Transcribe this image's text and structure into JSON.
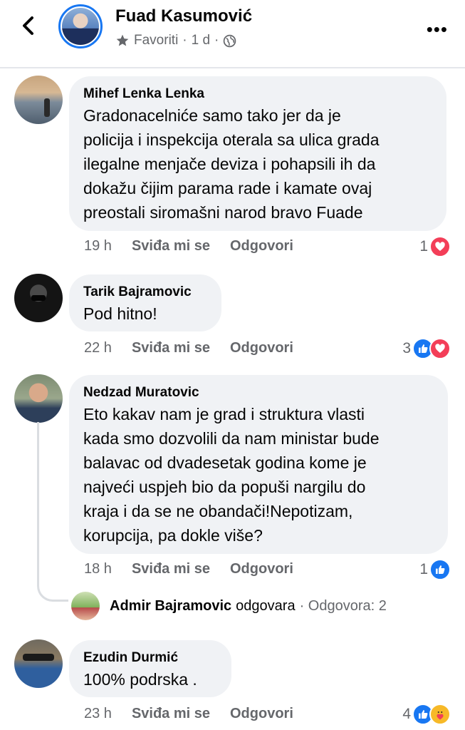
{
  "header": {
    "title": "Fuad Kasumović",
    "favorites": "Favoriti",
    "time": "1 d",
    "separator": "·"
  },
  "comments": [
    {
      "author": "Mihef Lenka Lenka",
      "text": "Gradonacelniće samo tako jer da je\npolicija i inspekcija oterala sa ulica grada\nilegalne menjače deviza i pohapsili ih da\ndokažu čijim parama rade i kamate ovaj\npreostali siromašni narod bravo Fuade",
      "time": "19 h",
      "like_label": "Sviđa mi se",
      "reply_label": "Odgovori",
      "reaction_count": "1",
      "reactions": [
        "heart-icon"
      ]
    },
    {
      "author": "Tarik Bajramovic",
      "text": "Pod hitno!",
      "time": "22 h",
      "like_label": "Sviđa mi se",
      "reply_label": "Odgovori",
      "reaction_count": "3",
      "reactions": [
        "thumbs-up-icon",
        "heart-icon"
      ]
    },
    {
      "author": "Nedzad Muratovic",
      "text": "Eto kakav nam je grad i struktura vlasti\nkada smo dozvolili da nam ministar bude\nbalavac od dvadesetak godina kome je\nnajveći uspjeh bio da popuši nargilu do\nkraja i da se ne obandači!Nepotizam,\nkorupcija, pa dokle više?",
      "time": "18 h",
      "like_label": "Sviđa mi se",
      "reply_label": "Odgovori",
      "reaction_count": "1",
      "reactions": [
        "thumbs-up-icon"
      ]
    },
    {
      "author": "Ezudin Durmić",
      "text": "100% podrska .",
      "time": "23 h",
      "like_label": "Sviđa mi se",
      "reply_label": "Odgovori",
      "reaction_count": "4",
      "reactions": [
        "thumbs-up-icon",
        "care-icon"
      ]
    }
  ],
  "reply_preview": {
    "name": "Admir Bajramovic",
    "verb": "odgovara",
    "count": "· Odgovora: 2"
  },
  "colors": {
    "bubble": "#f0f2f5",
    "secondary_text": "#65676b",
    "like_blue": "#1877f2",
    "love_red": "#f33e58",
    "care_yellow": "#f7b928"
  }
}
